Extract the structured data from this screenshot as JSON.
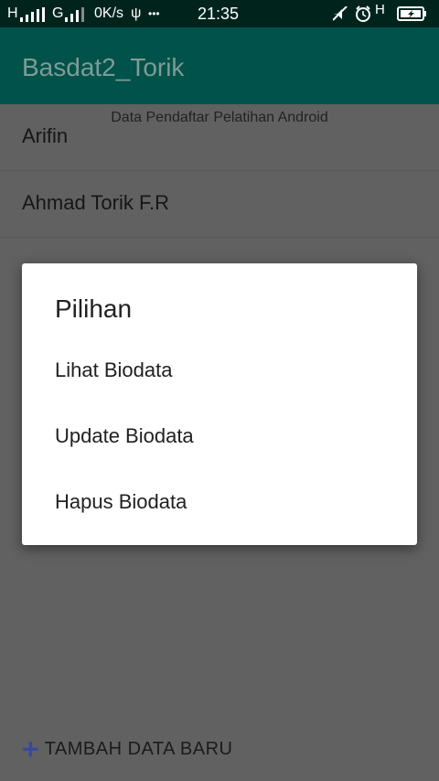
{
  "status_bar": {
    "sim1": "H",
    "sim2": "G",
    "speed": "0K/s",
    "usb_icon": "ψ",
    "more": "•••",
    "time": "21:35",
    "right_net": "H"
  },
  "app_bar": {
    "title": "Basdat2_Torik"
  },
  "content": {
    "header": "Data Pendaftar Pelatihan Android",
    "items": [
      {
        "name": "Arifin"
      },
      {
        "name": "Ahmad Torik F.R"
      }
    ],
    "add_button": {
      "icon": "+",
      "label": "TAMBAH DATA BARU"
    }
  },
  "dialog": {
    "title": "Pilihan",
    "options": [
      "Lihat Biodata",
      "Update Biodata",
      "Hapus Biodata"
    ]
  },
  "colors": {
    "status_bar": "#00241c",
    "app_bar": "#00524a",
    "dim_background": "#616161",
    "accent_plus": "#3a4a9a"
  }
}
